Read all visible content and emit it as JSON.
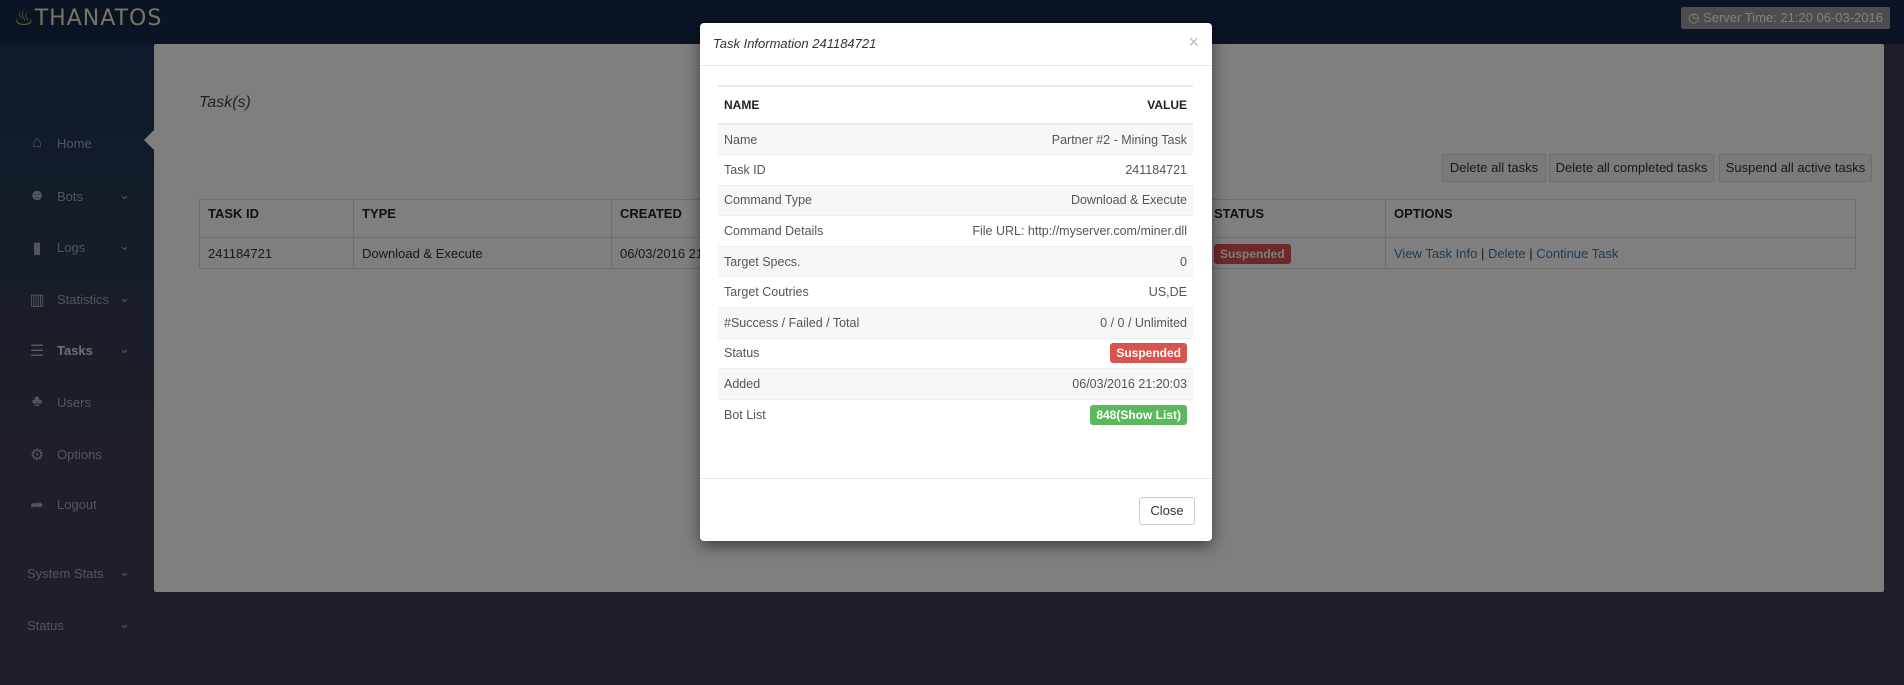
{
  "app": {
    "logo_text": "THANATOS",
    "server_time": "Server Time: 21:20 06-03-2016"
  },
  "sidebar": {
    "items": [
      {
        "label": "Home",
        "icon": "home-icon",
        "chevron": false
      },
      {
        "label": "Bots",
        "icon": "users-icon",
        "chevron": true
      },
      {
        "label": "Logs",
        "icon": "file-icon",
        "chevron": true
      },
      {
        "label": "Statistics",
        "icon": "bar-chart-icon",
        "chevron": true
      },
      {
        "label": "Tasks",
        "icon": "tasks-icon",
        "chevron": true
      },
      {
        "label": "Users",
        "icon": "sitemap-icon",
        "chevron": false
      },
      {
        "label": "Options",
        "icon": "gear-icon",
        "chevron": false
      },
      {
        "label": "Logout",
        "icon": "share-icon",
        "chevron": false
      }
    ],
    "sections": [
      {
        "label": "System Stats"
      },
      {
        "label": "Status"
      }
    ]
  },
  "main": {
    "title": "Task(s)",
    "buttons": {
      "delete_all": "Delete all tasks",
      "delete_completed": "Delete all completed tasks",
      "suspend_active": "Suspend all active tasks"
    },
    "table": {
      "headers": {
        "task_id": "TASK ID",
        "type": "TYPE",
        "created": "CREATED",
        "status": "STATUS",
        "options": "OPTIONS"
      },
      "rows": [
        {
          "task_id": "241184721",
          "type": "Download & Execute",
          "created": "06/03/2016 21:20:03",
          "status": "Suspended",
          "options": {
            "view": "View Task Info",
            "delete": "Delete",
            "continue": "Continue Task",
            "sep": "|"
          }
        }
      ]
    }
  },
  "modal": {
    "title": "Task Information 241184721",
    "close_x": "×",
    "headers": {
      "name": "NAME",
      "value": "VALUE"
    },
    "rows": [
      {
        "name": "Name",
        "value": "Partner #2 - Mining Task"
      },
      {
        "name": "Task ID",
        "value": "241184721"
      },
      {
        "name": "Command Type",
        "value": "Download & Execute"
      },
      {
        "name": "Command Details",
        "value": "File URL: http://myserver.com/miner.dll"
      },
      {
        "name": "Target Specs.",
        "value": "0"
      },
      {
        "name": "Target Coutries",
        "value": "US,DE"
      },
      {
        "name": "#Success / Failed / Total",
        "value": "0 / 0 / Unlimited"
      },
      {
        "name": "Status",
        "value": "Suspended"
      },
      {
        "name": "Added",
        "value": "06/03/2016 21:20:03"
      },
      {
        "name": "Bot List",
        "value": "848(Show List)"
      }
    ],
    "close_label": "Close"
  },
  "colors": {
    "danger": "#d9534f",
    "success": "#5cb85c",
    "link": "#337ab7",
    "topbar": "#16284a"
  }
}
